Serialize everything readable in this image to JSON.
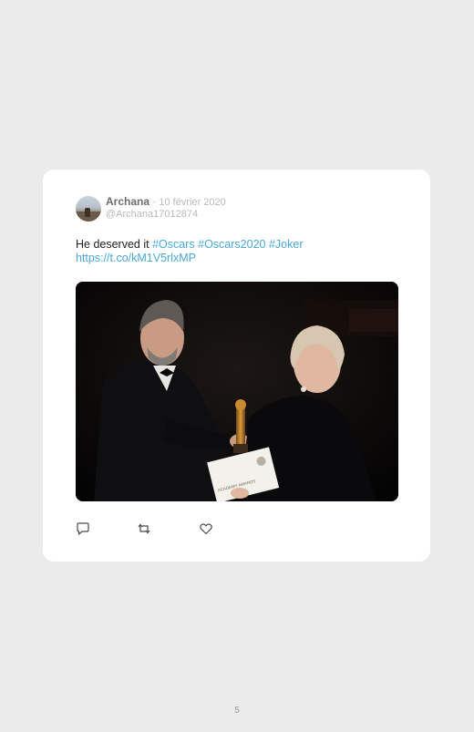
{
  "tweet": {
    "author_name": "Archana",
    "separator": "·",
    "date": "10 février 2020",
    "handle": "@Archana17012874",
    "text_before": "He deserved it",
    "hashtags": [
      "#Oscars",
      "#Oscars2020",
      "#Joker"
    ],
    "link": "https://t.co/kM1V5rlxMP",
    "photo_envelope_text": "ACADEMY AWARDS"
  },
  "icons": {
    "reply": "reply-icon",
    "retweet": "retweet-icon",
    "like": "heart-icon"
  },
  "colors": {
    "background": "#ebebeb",
    "card": "#ffffff",
    "hashtag": "#4aa8d8",
    "name": "#6e6e6e",
    "muted": "#b9b9b9"
  },
  "footer": {
    "page_number": "5"
  }
}
